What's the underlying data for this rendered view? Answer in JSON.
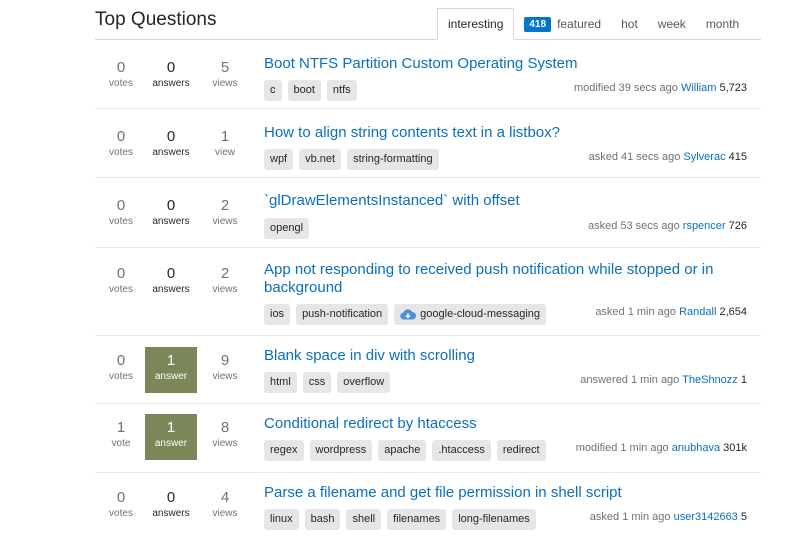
{
  "header": {
    "title": "Top Questions",
    "tabs": [
      {
        "label": "interesting",
        "active": true
      },
      {
        "label": "featured",
        "badge": "418"
      },
      {
        "label": "hot"
      },
      {
        "label": "week"
      },
      {
        "label": "month"
      }
    ]
  },
  "questions": [
    {
      "votes": "0",
      "votes_label": "votes",
      "answers": "0",
      "answers_label": "answers",
      "views": "5",
      "views_label": "views",
      "title": "Boot NTFS Partition Custom Operating System",
      "tags": [
        "c",
        "boot",
        "ntfs"
      ],
      "action": "modified 39 secs ago",
      "user": "William",
      "rep": "5,723"
    },
    {
      "votes": "0",
      "votes_label": "votes",
      "answers": "0",
      "answers_label": "answers",
      "views": "1",
      "views_label": "view",
      "title": "How to align string contents text in a listbox?",
      "tags": [
        "wpf",
        "vb.net",
        "string-formatting"
      ],
      "action": "asked 41 secs ago",
      "user": "Sylverac",
      "rep": "415"
    },
    {
      "votes": "0",
      "votes_label": "votes",
      "answers": "0",
      "answers_label": "answers",
      "views": "2",
      "views_label": "views",
      "title": "`glDrawElementsInstanced` with offset",
      "tags": [
        "opengl"
      ],
      "action": "asked 53 secs ago",
      "user": "rspencer",
      "rep": "726"
    },
    {
      "votes": "0",
      "votes_label": "votes",
      "answers": "0",
      "answers_label": "answers",
      "views": "2",
      "views_label": "views",
      "title": "App not responding to received push notification while stopped or in background",
      "tags": [
        "ios",
        "push-notification",
        "google-cloud-messaging"
      ],
      "action": "asked 1 min ago",
      "user": "Randall",
      "rep": "2,654"
    },
    {
      "votes": "0",
      "votes_label": "votes",
      "answers": "1",
      "answers_label": "answer",
      "views": "9",
      "views_label": "views",
      "title": "Blank space in div with scrolling",
      "tags": [
        "html",
        "css",
        "overflow"
      ],
      "action": "answered 1 min ago",
      "user": "TheShnozz",
      "rep": "1"
    },
    {
      "votes": "1",
      "votes_label": "vote",
      "answers": "1",
      "answers_label": "answer",
      "views": "8",
      "views_label": "views",
      "title": "Conditional redirect by htaccess",
      "tags": [
        "regex",
        "wordpress",
        "apache",
        ".htaccess",
        "redirect"
      ],
      "action": "modified 1 min ago",
      "user": "anubhava",
      "rep": "301k"
    },
    {
      "votes": "0",
      "votes_label": "votes",
      "answers": "0",
      "answers_label": "answers",
      "views": "4",
      "views_label": "views",
      "title": "Parse a filename and get file permission in shell script",
      "tags": [
        "linux",
        "bash",
        "shell",
        "filenames",
        "long-filenames"
      ],
      "action": "asked 1 min ago",
      "user": "user3142663",
      "rep": "5"
    }
  ]
}
